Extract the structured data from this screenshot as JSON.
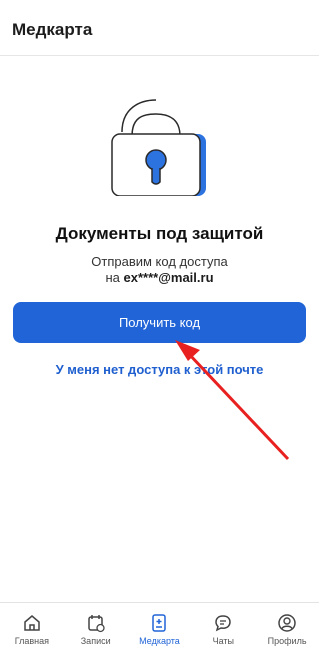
{
  "header": {
    "title": "Медкарта"
  },
  "main": {
    "title": "Документы под защитой",
    "subtitle": "Отправим код доступа",
    "email_prefix": "на",
    "email": "ex****@mail.ru",
    "primary_button": "Получить код",
    "no_access_link": "У меня нет доступа к этой почте"
  },
  "colors": {
    "accent": "#2064d7",
    "arrow": "#e8201f"
  },
  "tabbar": {
    "items": [
      {
        "label": "Главная",
        "icon": "home-icon"
      },
      {
        "label": "Записи",
        "icon": "calendar-icon"
      },
      {
        "label": "Медкарта",
        "icon": "medcard-icon",
        "active": true
      },
      {
        "label": "Чаты",
        "icon": "chat-icon"
      },
      {
        "label": "Профиль",
        "icon": "profile-icon"
      }
    ]
  }
}
